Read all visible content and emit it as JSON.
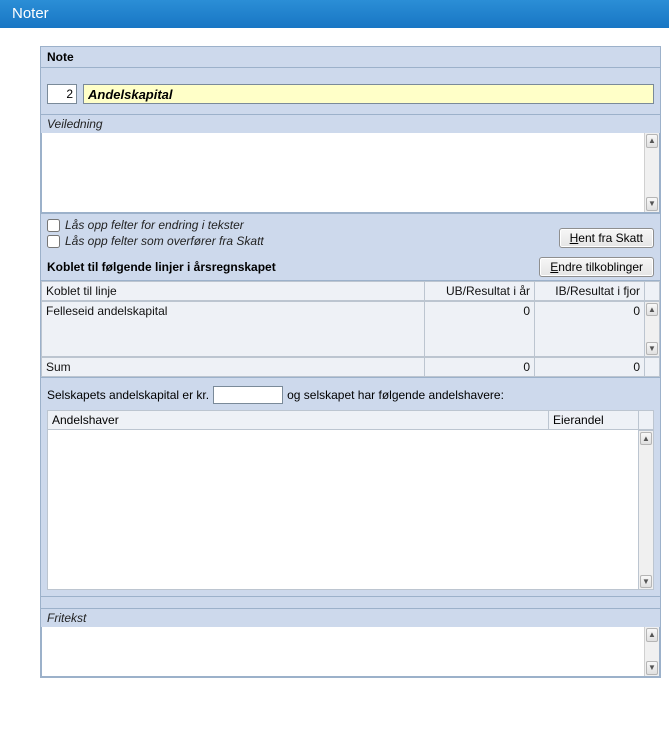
{
  "window": {
    "title": "Noter"
  },
  "note": {
    "header": "Note",
    "number": "2",
    "title": "Andelskapital"
  },
  "guidance": {
    "label": "Veiledning",
    "text": ""
  },
  "options": {
    "unlock_texts": "Lås opp felter for endring i tekster",
    "unlock_skatt": "Lås opp felter som overfører fra Skatt",
    "fetch_btn_prefix": "H",
    "fetch_btn_suffix": "ent fra Skatt"
  },
  "linked": {
    "header": "Koblet til følgende linjer i årsregnskapet",
    "edit_btn_prefix": "E",
    "edit_btn_suffix": "ndre tilkoblinger",
    "columns": {
      "line": "Koblet til linje",
      "ub": "UB/Resultat i år",
      "ib": "IB/Resultat i fjor"
    },
    "rows": [
      {
        "line": "Felleseid andelskapital",
        "ub": "0",
        "ib": "0"
      }
    ],
    "sum_label": "Sum",
    "sum_ub": "0",
    "sum_ib": "0"
  },
  "capital": {
    "sentence_a": "Selskapets andelskapital er kr.",
    "amount": "",
    "sentence_b": "og selskapet har følgende andelshavere:"
  },
  "owners": {
    "col_name": "Andelshaver",
    "col_share": "Eierandel"
  },
  "freetext": {
    "label": "Fritekst",
    "text": ""
  }
}
